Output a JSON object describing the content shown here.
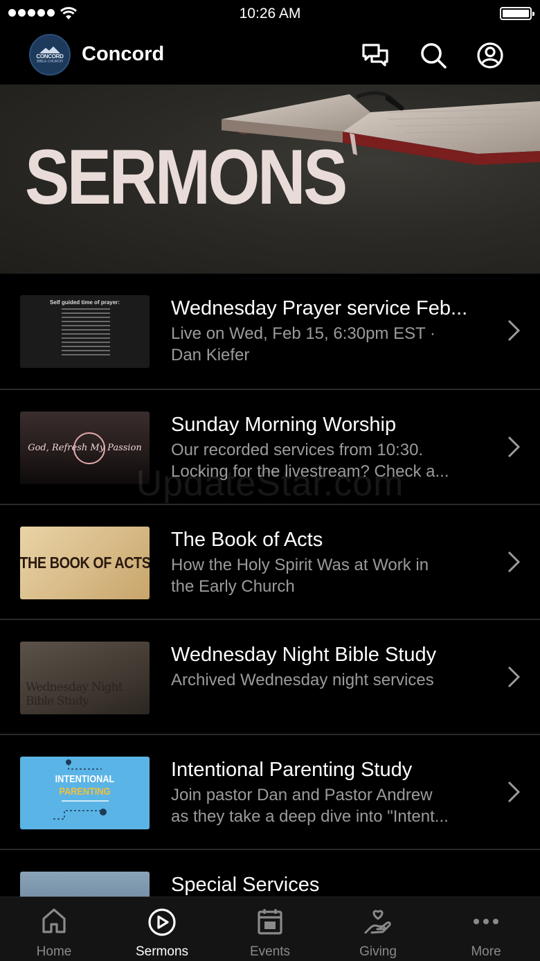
{
  "status_bar": {
    "time": "10:26 AM"
  },
  "header": {
    "title": "Concord",
    "logo_text": "CONCORD",
    "logo_sub": "BIBLE CHURCH",
    "icons": [
      "chat-icon",
      "search-icon",
      "profile-icon"
    ]
  },
  "banner": {
    "title": "SERMONS"
  },
  "sermons": [
    {
      "title": "Wednesday Prayer service Feb...",
      "subtitle_lines": [
        "Live on Wed, Feb 15, 6:30pm EST ·",
        "Dan Kiefer"
      ],
      "thumb_text": "Self guided time of prayer:"
    },
    {
      "title": "Sunday Morning Worship",
      "subtitle_lines": [
        "Our recorded services from 10:30.",
        "Locking for the livestream? Check a..."
      ],
      "thumb_text": "God, Refresh My Passion"
    },
    {
      "title": "The Book of Acts",
      "subtitle_lines": [
        "How the Holy Spirit Was at Work in",
        "the Early Church"
      ],
      "thumb_text": "THE BOOK OF ACTS"
    },
    {
      "title": "Wednesday Night Bible Study",
      "subtitle_lines": [
        "Archived Wednesday night services"
      ],
      "thumb_text": "Wednesday Night Bible Study"
    },
    {
      "title": "Intentional Parenting Study",
      "subtitle_lines": [
        "Join pastor Dan and Pastor Andrew",
        "as they take a deep dive into \"Intent..."
      ],
      "thumb_text_a": "INTENTIONAL",
      "thumb_text_b": "PARENTING"
    },
    {
      "title": "Special Services",
      "subtitle_lines": []
    }
  ],
  "watermark": "UpdateStar.com",
  "tabs": [
    {
      "label": "Home",
      "icon": "home-icon",
      "active": false
    },
    {
      "label": "Sermons",
      "icon": "play-circle-icon",
      "active": true
    },
    {
      "label": "Events",
      "icon": "calendar-icon",
      "active": false
    },
    {
      "label": "Giving",
      "icon": "giving-hand-icon",
      "active": false
    },
    {
      "label": "More",
      "icon": "more-dots-icon",
      "active": false
    }
  ]
}
